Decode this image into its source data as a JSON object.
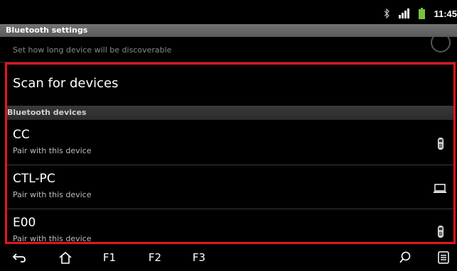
{
  "status_bar": {
    "time": "11:45",
    "icons": [
      "bluetooth-icon",
      "signal-icon",
      "battery-icon"
    ]
  },
  "header": {
    "title": "Bluetooth settings"
  },
  "discoverable": {
    "subtitle": "Set how long device will be discoverable"
  },
  "scan": {
    "label": "Scan for devices"
  },
  "devices_section": {
    "title": "Bluetooth devices"
  },
  "devices": [
    {
      "name": "CC",
      "status": "Pair with this device",
      "icon": "phone-icon"
    },
    {
      "name": "CTL-PC",
      "status": "Pair with this device",
      "icon": "laptop-icon"
    },
    {
      "name": "E00",
      "status": "Pair with this device",
      "icon": "phone-icon"
    }
  ],
  "nav": {
    "f1": "F1",
    "f2": "F2",
    "f3": "F3",
    "icons": [
      "back-icon",
      "home-icon",
      "search-icon",
      "menu-icon"
    ]
  },
  "colors": {
    "highlight": "#e8141c",
    "battery": "#7ac143",
    "background": "#000000"
  }
}
